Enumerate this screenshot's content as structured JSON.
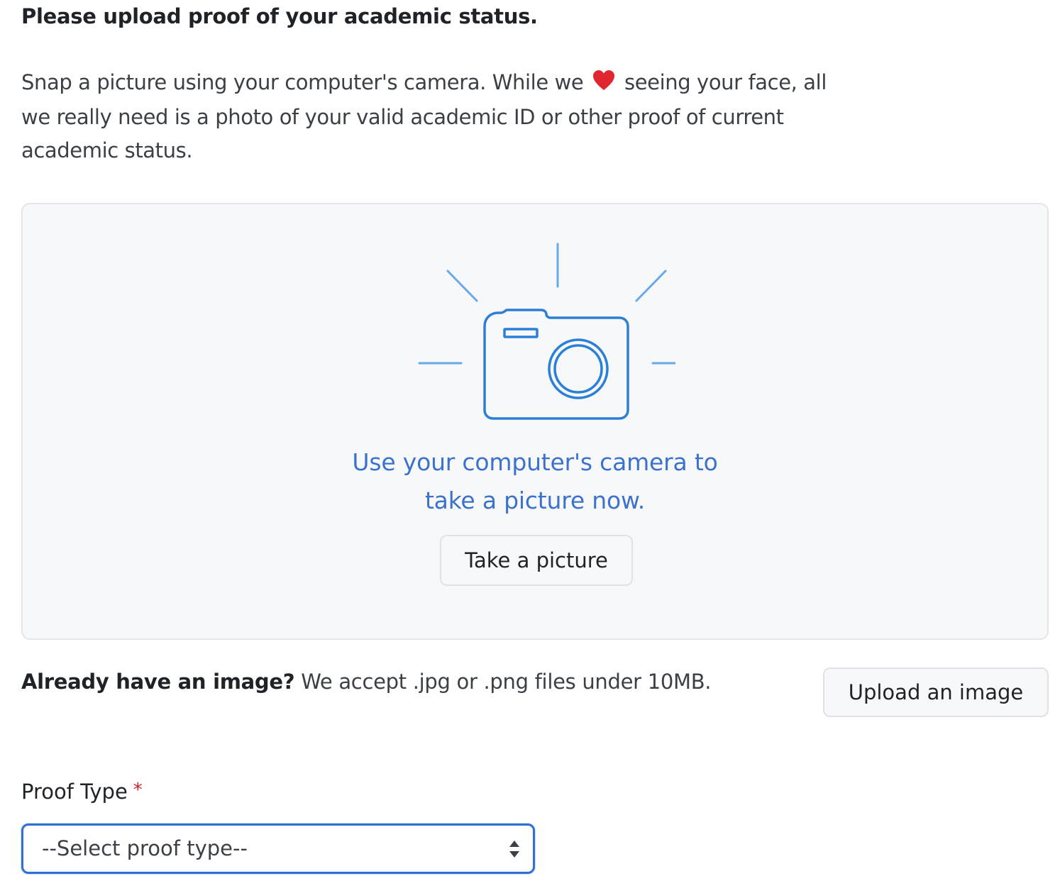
{
  "heading": "Please upload proof of your academic status.",
  "intro": {
    "before_heart": "Snap a picture using your computer's camera. While we",
    "after_heart": "seeing your face, all we really need is a photo of your valid academic ID or other proof of current academic status.",
    "heart_icon": "heart-icon",
    "heart_color": "#e0262e"
  },
  "camera_panel": {
    "icon": "camera-icon",
    "accent_color": "#3c72cc",
    "caption_line1": "Use your computer's camera to",
    "caption_line2": "take a picture now.",
    "button_label": "Take a picture"
  },
  "upload": {
    "bold_text": "Already have an image?",
    "text": "We accept .jpg or .png files under 10MB.",
    "button_label": "Upload an image"
  },
  "proof_type": {
    "label": "Proof Type",
    "required_mark": "*",
    "selected_value": "--Select proof type--",
    "focus_color": "#2f6fd6"
  }
}
